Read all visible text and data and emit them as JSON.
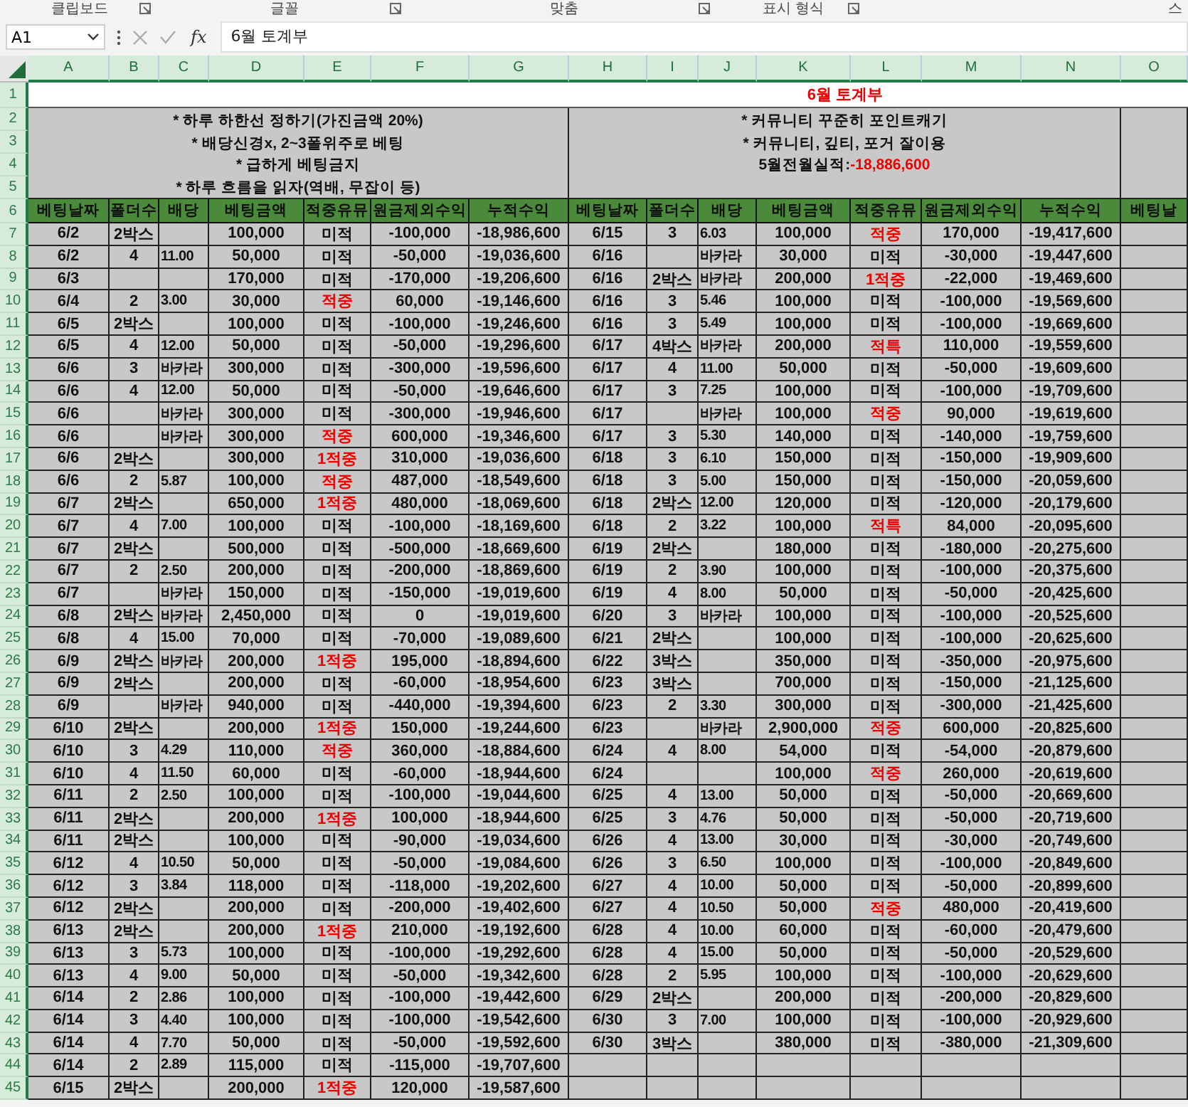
{
  "ribbon_groups": [
    "클립보드",
    "글꼴",
    "맞춤",
    "표시 형식",
    "스"
  ],
  "formula_bar": {
    "name_box": "A1",
    "function_label": "fx",
    "formula": "6월 토계부"
  },
  "column_headers": [
    "A",
    "B",
    "C",
    "D",
    "E",
    "F",
    "G",
    "H",
    "I",
    "J",
    "K",
    "L",
    "M",
    "N",
    "O"
  ],
  "row_numbers": [
    "1",
    "2",
    "3",
    "4",
    "5",
    "6",
    "7",
    "8",
    "9",
    "10",
    "11",
    "12",
    "13",
    "14",
    "15",
    "16",
    "17",
    "18",
    "19",
    "20",
    "21",
    "22",
    "23",
    "24",
    "25",
    "26",
    "27",
    "28",
    "29",
    "30",
    "31",
    "32",
    "33",
    "34",
    "35",
    "36",
    "37",
    "38",
    "39",
    "40",
    "41",
    "42",
    "43",
    "44",
    "45"
  ],
  "title": "6월 토계부",
  "notes_left": [
    "* 하루 하한선 정하기(가진금액 20%)",
    "* 배당신경x, 2~3폴위주로 베팅",
    "* 급하게 베팅금지",
    "* 하루 흐름을 읽자(역배, 무잡이 등)"
  ],
  "notes_right": [
    "* 커뮤니티 꾸준히 포인트캐기",
    "* 커뮤니티, 깊티, 포거 잘이용"
  ],
  "record": {
    "label": "5월전월실적:",
    "value": "-18,886,600"
  },
  "table_headers": [
    "베팅날짜",
    "폴더수",
    "배당",
    "베팅금액",
    "적중유뮤",
    "원금제외수익",
    "누적수익"
  ],
  "table_headers_right": [
    "베팅날짜",
    "폴더수",
    "배당",
    "베팅금액",
    "적중유뮤",
    "원금제외수익",
    "누적수익"
  ],
  "next_header": "베팅날",
  "left_rows": [
    {
      "date": "6/2",
      "folds": "2박스",
      "stake": "100,000",
      "result": "미적",
      "hit": false,
      "profit": "-100,000",
      "total": "-18,986,600"
    },
    {
      "date": "6/2",
      "folds": "4",
      "odds": "11.00",
      "stake": "50,000",
      "result": "미적",
      "hit": false,
      "profit": "-50,000",
      "total": "-19,036,600"
    },
    {
      "date": "6/3",
      "stake": "170,000",
      "result": "미적",
      "hit": false,
      "profit": "-170,000",
      "total": "-19,206,600"
    },
    {
      "date": "6/4",
      "folds": "2",
      "odds": "3.00",
      "stake": "30,000",
      "result": "적중",
      "hit": true,
      "profit": "60,000",
      "total": "-19,146,600"
    },
    {
      "date": "6/5",
      "folds": "2박스",
      "stake": "100,000",
      "result": "미적",
      "hit": false,
      "profit": "-100,000",
      "total": "-19,246,600"
    },
    {
      "date": "6/5",
      "folds": "4",
      "odds": "12.00",
      "stake": "50,000",
      "result": "미적",
      "hit": false,
      "profit": "-50,000",
      "total": "-19,296,600"
    },
    {
      "date": "6/6",
      "folds": "3",
      "odds": "바카라",
      "stake": "300,000",
      "result": "미적",
      "hit": false,
      "profit": "-300,000",
      "total": "-19,596,600"
    },
    {
      "date": "6/6",
      "folds": "4",
      "odds": "12.00",
      "stake": "50,000",
      "result": "미적",
      "hit": false,
      "profit": "-50,000",
      "total": "-19,646,600"
    },
    {
      "date": "6/6",
      "odds": "바카라",
      "stake": "300,000",
      "result": "미적",
      "hit": false,
      "profit": "-300,000",
      "total": "-19,946,600"
    },
    {
      "date": "6/6",
      "odds": "바카라",
      "stake": "300,000",
      "result": "적중",
      "hit": true,
      "profit": "600,000",
      "total": "-19,346,600"
    },
    {
      "date": "6/6",
      "folds": "2박스",
      "stake": "300,000",
      "result": "1적중",
      "hit": true,
      "profit": "310,000",
      "total": "-19,036,600"
    },
    {
      "date": "6/6",
      "folds": "2",
      "odds": "5.87",
      "stake": "100,000",
      "result": "적중",
      "hit": true,
      "profit": "487,000",
      "total": "-18,549,600"
    },
    {
      "date": "6/7",
      "folds": "2박스",
      "stake": "650,000",
      "result": "1적중",
      "hit": true,
      "profit": "480,000",
      "total": "-18,069,600"
    },
    {
      "date": "6/7",
      "folds": "4",
      "odds": "7.00",
      "stake": "100,000",
      "result": "미적",
      "hit": false,
      "profit": "-100,000",
      "total": "-18,169,600"
    },
    {
      "date": "6/7",
      "folds": "2박스",
      "stake": "500,000",
      "result": "미적",
      "hit": false,
      "profit": "-500,000",
      "total": "-18,669,600"
    },
    {
      "date": "6/7",
      "folds": "2",
      "odds": "2.50",
      "stake": "200,000",
      "result": "미적",
      "hit": false,
      "profit": "-200,000",
      "total": "-18,869,600"
    },
    {
      "date": "6/7",
      "odds": "바카라",
      "stake": "150,000",
      "result": "미적",
      "hit": false,
      "profit": "-150,000",
      "total": "-19,019,600"
    },
    {
      "date": "6/8",
      "folds": "2박스",
      "odds": "바카라",
      "stake": "2,450,000",
      "result": "미적",
      "hit": false,
      "profit": "0",
      "total": "-19,019,600"
    },
    {
      "date": "6/8",
      "folds": "4",
      "odds": "15.00",
      "stake": "70,000",
      "result": "미적",
      "hit": false,
      "profit": "-70,000",
      "total": "-19,089,600"
    },
    {
      "date": "6/9",
      "folds": "2박스",
      "odds": "바카라",
      "stake": "200,000",
      "result": "1적중",
      "hit": true,
      "profit": "195,000",
      "total": "-18,894,600"
    },
    {
      "date": "6/9",
      "folds": "2박스",
      "stake": "200,000",
      "result": "미적",
      "hit": false,
      "profit": "-60,000",
      "total": "-18,954,600"
    },
    {
      "date": "6/9",
      "odds": "바카라",
      "stake": "940,000",
      "result": "미적",
      "hit": false,
      "profit": "-440,000",
      "total": "-19,394,600"
    },
    {
      "date": "6/10",
      "folds": "2박스",
      "stake": "200,000",
      "result": "1적중",
      "hit": true,
      "profit": "150,000",
      "total": "-19,244,600"
    },
    {
      "date": "6/10",
      "folds": "3",
      "odds": "4.29",
      "stake": "110,000",
      "result": "적중",
      "hit": true,
      "profit": "360,000",
      "total": "-18,884,600"
    },
    {
      "date": "6/10",
      "folds": "4",
      "odds": "11.50",
      "stake": "60,000",
      "result": "미적",
      "hit": false,
      "profit": "-60,000",
      "total": "-18,944,600"
    },
    {
      "date": "6/11",
      "folds": "2",
      "odds": "2.50",
      "stake": "100,000",
      "result": "미적",
      "hit": false,
      "profit": "-100,000",
      "total": "-19,044,600"
    },
    {
      "date": "6/11",
      "folds": "2박스",
      "stake": "200,000",
      "result": "1적중",
      "hit": true,
      "profit": "100,000",
      "total": "-18,944,600"
    },
    {
      "date": "6/11",
      "folds": "2박스",
      "stake": "100,000",
      "result": "미적",
      "hit": false,
      "profit": "-90,000",
      "total": "-19,034,600"
    },
    {
      "date": "6/12",
      "folds": "4",
      "odds": "10.50",
      "stake": "50,000",
      "result": "미적",
      "hit": false,
      "profit": "-50,000",
      "total": "-19,084,600"
    },
    {
      "date": "6/12",
      "folds": "3",
      "odds": "3.84",
      "stake": "118,000",
      "result": "미적",
      "hit": false,
      "profit": "-118,000",
      "total": "-19,202,600"
    },
    {
      "date": "6/12",
      "folds": "2박스",
      "stake": "200,000",
      "result": "미적",
      "hit": false,
      "profit": "-200,000",
      "total": "-19,402,600"
    },
    {
      "date": "6/13",
      "folds": "2박스",
      "stake": "200,000",
      "result": "1적중",
      "hit": true,
      "profit": "210,000",
      "total": "-19,192,600"
    },
    {
      "date": "6/13",
      "folds": "3",
      "odds": "5.73",
      "stake": "100,000",
      "result": "미적",
      "hit": false,
      "profit": "-100,000",
      "total": "-19,292,600"
    },
    {
      "date": "6/13",
      "folds": "4",
      "odds": "9.00",
      "stake": "50,000",
      "result": "미적",
      "hit": false,
      "profit": "-50,000",
      "total": "-19,342,600"
    },
    {
      "date": "6/14",
      "folds": "2",
      "odds": "2.86",
      "stake": "100,000",
      "result": "미적",
      "hit": false,
      "profit": "-100,000",
      "total": "-19,442,600"
    },
    {
      "date": "6/14",
      "folds": "3",
      "odds": "4.40",
      "stake": "100,000",
      "result": "미적",
      "hit": false,
      "profit": "-100,000",
      "total": "-19,542,600"
    },
    {
      "date": "6/14",
      "folds": "4",
      "odds": "7.70",
      "stake": "50,000",
      "result": "미적",
      "hit": false,
      "profit": "-50,000",
      "total": "-19,592,600"
    },
    {
      "date": "6/14",
      "folds": "2",
      "odds": "2.89",
      "stake": "115,000",
      "result": "미적",
      "hit": false,
      "profit": "-115,000",
      "total": "-19,707,600"
    },
    {
      "date": "6/15",
      "folds": "2박스",
      "stake": "200,000",
      "result": "1적중",
      "hit": true,
      "profit": "120,000",
      "total": "-19,587,600"
    }
  ],
  "right_rows": [
    {
      "date": "6/15",
      "folds": "3",
      "odds": "6.03",
      "stake": "100,000",
      "result": "적중",
      "hit": true,
      "profit": "170,000",
      "total": "-19,417,600"
    },
    {
      "date": "6/16",
      "odds": "바카라",
      "stake": "30,000",
      "result": "미적",
      "hit": false,
      "profit": "-30,000",
      "total": "-19,447,600"
    },
    {
      "date": "6/16",
      "folds": "2박스",
      "odds": "바카라",
      "stake": "200,000",
      "result": "1적중",
      "hit": true,
      "profit": "-22,000",
      "total": "-19,469,600"
    },
    {
      "date": "6/16",
      "folds": "3",
      "odds": "5.46",
      "stake": "100,000",
      "result": "미적",
      "hit": false,
      "profit": "-100,000",
      "total": "-19,569,600"
    },
    {
      "date": "6/16",
      "folds": "3",
      "odds": "5.49",
      "stake": "100,000",
      "result": "미적",
      "hit": false,
      "profit": "-100,000",
      "total": "-19,669,600"
    },
    {
      "date": "6/17",
      "folds": "4박스",
      "odds": "바카라",
      "stake": "200,000",
      "result": "적특",
      "hit": true,
      "profit": "110,000",
      "total": "-19,559,600"
    },
    {
      "date": "6/17",
      "folds": "4",
      "odds": "11.00",
      "stake": "50,000",
      "result": "미적",
      "hit": false,
      "profit": "-50,000",
      "total": "-19,609,600"
    },
    {
      "date": "6/17",
      "folds": "3",
      "odds": "7.25",
      "stake": "100,000",
      "result": "미적",
      "hit": false,
      "profit": "-100,000",
      "total": "-19,709,600"
    },
    {
      "date": "6/17",
      "odds": "바카라",
      "stake": "100,000",
      "result": "적중",
      "hit": true,
      "profit": "90,000",
      "total": "-19,619,600"
    },
    {
      "date": "6/17",
      "folds": "3",
      "odds": "5.30",
      "stake": "140,000",
      "result": "미적",
      "hit": false,
      "profit": "-140,000",
      "total": "-19,759,600"
    },
    {
      "date": "6/18",
      "folds": "3",
      "odds": "6.10",
      "stake": "150,000",
      "result": "미적",
      "hit": false,
      "profit": "-150,000",
      "total": "-19,909,600"
    },
    {
      "date": "6/18",
      "folds": "3",
      "odds": "5.00",
      "stake": "150,000",
      "result": "미적",
      "hit": false,
      "profit": "-150,000",
      "total": "-20,059,600"
    },
    {
      "date": "6/18",
      "folds": "2박스",
      "odds": "12.00",
      "stake": "120,000",
      "result": "미적",
      "hit": false,
      "profit": "-120,000",
      "total": "-20,179,600"
    },
    {
      "date": "6/18",
      "folds": "2",
      "odds": "3.22",
      "stake": "100,000",
      "result": "적특",
      "hit": true,
      "profit": "84,000",
      "total": "-20,095,600"
    },
    {
      "date": "6/19",
      "folds": "2박스",
      "stake": "180,000",
      "result": "미적",
      "hit": false,
      "profit": "-180,000",
      "total": "-20,275,600"
    },
    {
      "date": "6/19",
      "folds": "2",
      "odds": "3.90",
      "stake": "100,000",
      "result": "미적",
      "hit": false,
      "profit": "-100,000",
      "total": "-20,375,600"
    },
    {
      "date": "6/19",
      "folds": "4",
      "odds": "8.00",
      "stake": "50,000",
      "result": "미적",
      "hit": false,
      "profit": "-50,000",
      "total": "-20,425,600"
    },
    {
      "date": "6/20",
      "folds": "3",
      "odds": "바카라",
      "stake": "100,000",
      "result": "미적",
      "hit": false,
      "profit": "-100,000",
      "total": "-20,525,600"
    },
    {
      "date": "6/21",
      "folds": "2박스",
      "stake": "100,000",
      "result": "미적",
      "hit": false,
      "profit": "-100,000",
      "total": "-20,625,600"
    },
    {
      "date": "6/22",
      "folds": "3박스",
      "stake": "350,000",
      "result": "미적",
      "hit": false,
      "profit": "-350,000",
      "total": "-20,975,600"
    },
    {
      "date": "6/23",
      "folds": "3박스",
      "stake": "700,000",
      "result": "미적",
      "hit": false,
      "profit": "-150,000",
      "total": "-21,125,600"
    },
    {
      "date": "6/23",
      "folds": "2",
      "odds": "3.30",
      "stake": "300,000",
      "result": "미적",
      "hit": false,
      "profit": "-300,000",
      "total": "-21,425,600"
    },
    {
      "date": "6/23",
      "odds": "바카라",
      "stake": "2,900,000",
      "result": "적중",
      "hit": true,
      "profit": "600,000",
      "total": "-20,825,600"
    },
    {
      "date": "6/24",
      "folds": "4",
      "odds": "8.00",
      "stake": "54,000",
      "result": "미적",
      "hit": false,
      "profit": "-54,000",
      "total": "-20,879,600"
    },
    {
      "date": "6/24",
      "stake": "100,000",
      "result": "적중",
      "hit": true,
      "profit": "260,000",
      "total": "-20,619,600"
    },
    {
      "date": "6/25",
      "folds": "4",
      "odds": "13.00",
      "stake": "50,000",
      "result": "미적",
      "hit": false,
      "profit": "-50,000",
      "total": "-20,669,600"
    },
    {
      "date": "6/25",
      "folds": "3",
      "odds": "4.76",
      "stake": "50,000",
      "result": "미적",
      "hit": false,
      "profit": "-50,000",
      "total": "-20,719,600"
    },
    {
      "date": "6/26",
      "folds": "4",
      "odds": "13.00",
      "stake": "30,000",
      "result": "미적",
      "hit": false,
      "profit": "-30,000",
      "total": "-20,749,600"
    },
    {
      "date": "6/26",
      "folds": "3",
      "odds": "6.50",
      "stake": "100,000",
      "result": "미적",
      "hit": false,
      "profit": "-100,000",
      "total": "-20,849,600"
    },
    {
      "date": "6/27",
      "folds": "4",
      "odds": "10.00",
      "stake": "50,000",
      "result": "미적",
      "hit": false,
      "profit": "-50,000",
      "total": "-20,899,600"
    },
    {
      "date": "6/27",
      "folds": "4",
      "odds": "10.50",
      "stake": "50,000",
      "result": "적중",
      "hit": true,
      "profit": "480,000",
      "total": "-20,419,600"
    },
    {
      "date": "6/28",
      "folds": "4",
      "odds": "10.00",
      "stake": "60,000",
      "result": "미적",
      "hit": false,
      "profit": "-60,000",
      "total": "-20,479,600"
    },
    {
      "date": "6/28",
      "folds": "4",
      "odds": "15.00",
      "stake": "50,000",
      "result": "미적",
      "hit": false,
      "profit": "-50,000",
      "total": "-20,529,600"
    },
    {
      "date": "6/28",
      "folds": "2",
      "odds": "5.95",
      "stake": "100,000",
      "result": "미적",
      "hit": false,
      "profit": "-100,000",
      "total": "-20,629,600"
    },
    {
      "date": "6/29",
      "folds": "2박스",
      "stake": "200,000",
      "result": "미적",
      "hit": false,
      "profit": "-200,000",
      "total": "-20,829,600"
    },
    {
      "date": "6/30",
      "folds": "3",
      "odds": "7.00",
      "stake": "100,000",
      "result": "미적",
      "hit": false,
      "profit": "-100,000",
      "total": "-20,929,600"
    },
    {
      "date": "6/30",
      "folds": "3박스",
      "stake": "380,000",
      "result": "미적",
      "hit": false,
      "profit": "-380,000",
      "total": "-21,309,600"
    }
  ]
}
